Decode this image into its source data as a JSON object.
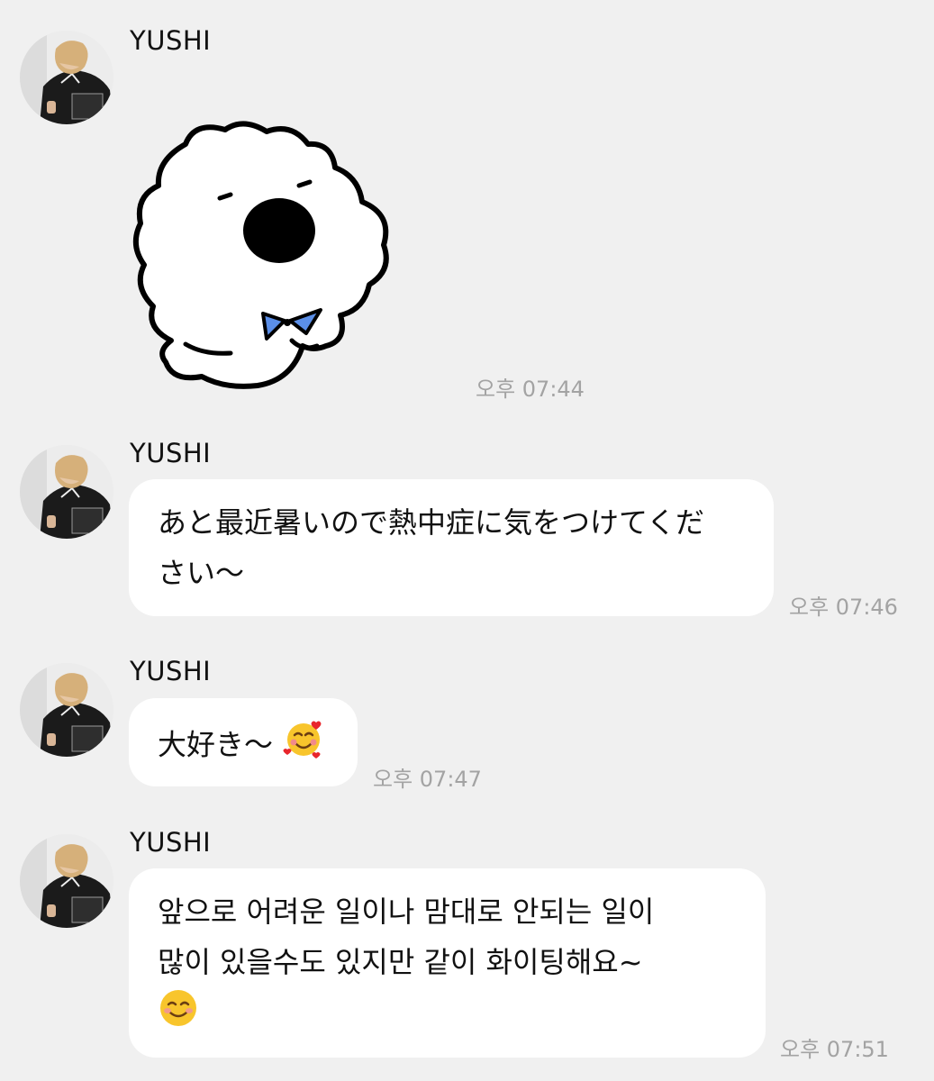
{
  "messages": [
    {
      "sender": "YUSHI",
      "type": "sticker",
      "sticker_icon": "white-puppy-bowtie-sticker",
      "time": "오후 07:44"
    },
    {
      "sender": "YUSHI",
      "type": "text",
      "lines": [
        "あと最近暑いので熱中症に気をつけてくだ",
        "さい～"
      ],
      "time": "오후 07:46"
    },
    {
      "sender": "YUSHI",
      "type": "text",
      "lines": [
        "大好き～"
      ],
      "emoji": "smiling-face-with-hearts",
      "time": "오후 07:47"
    },
    {
      "sender": "YUSHI",
      "type": "text",
      "lines": [
        "앞으로 어려운 일이나 맘대로 안되는 일이",
        "많이 있을수도 있지만 같이 화이팅해요~"
      ],
      "emoji": "smiling-face",
      "time": "오후 07:51"
    }
  ],
  "colors": {
    "background": "#f0f0f0",
    "bubble": "#ffffff",
    "timestamp": "#a3a3a3",
    "bowtie": "#5b8fe8"
  }
}
